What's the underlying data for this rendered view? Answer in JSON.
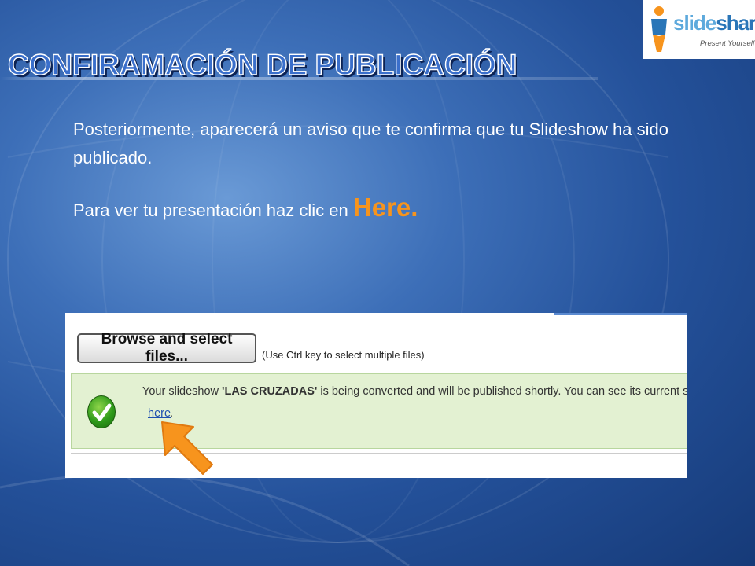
{
  "slide": {
    "title": "CONFIRAMACIÓN DE PUBLICACIÓN",
    "paragraph1": "Posteriormente, aparecerá un aviso que te confirma que tu Slideshow ha sido publicado.",
    "paragraph2_prefix": "Para ver tu presentación haz clic en ",
    "paragraph2_link": "Here.",
    "accent_color": "#f7941d"
  },
  "logo": {
    "word_part1": "slide",
    "word_part2": "share",
    "tagline": "Present Yourself"
  },
  "screenshot": {
    "browse_button_label": "Browse and select files...",
    "browse_hint": "(Use Ctrl key to select multiple files)",
    "notice_prefix": "Your slideshow ",
    "notice_name": "'LAS CRUZADAS'",
    "notice_suffix": " is being converted and will be published shortly. You can see its current s",
    "link_label": "here",
    "link_suffix": ".",
    "status_icon": "check-icon",
    "pointer_icon": "arrow-icon"
  }
}
